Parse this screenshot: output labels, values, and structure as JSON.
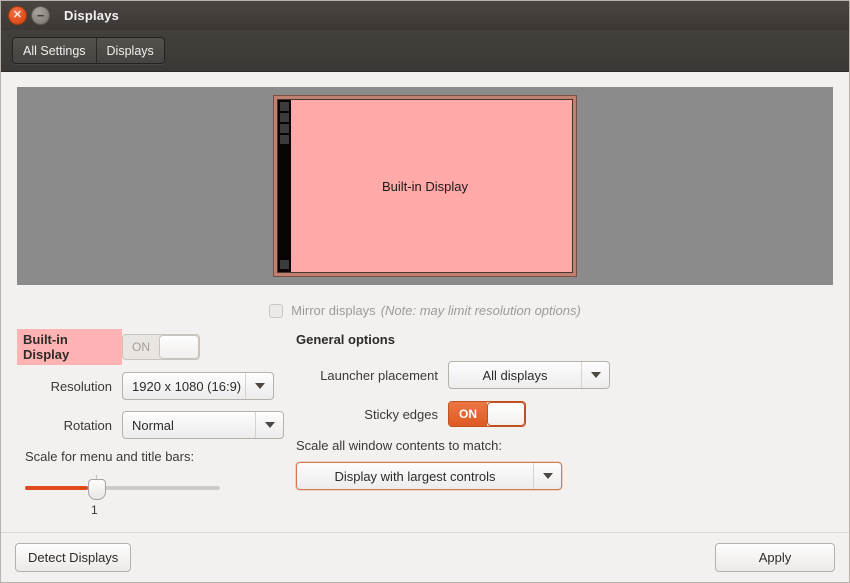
{
  "window": {
    "title": "Displays",
    "close_icon": "close-icon",
    "minimize_icon": "minimize-icon"
  },
  "toolbar": {
    "buttons": [
      {
        "label": "All Settings"
      },
      {
        "label": "Displays"
      }
    ]
  },
  "preview": {
    "monitor_label": "Built-in Display",
    "screen_color": "#ffa9a9",
    "bezel_color": "#c08070",
    "background_color": "#8b8b8b",
    "launcher_color": "#080404"
  },
  "mirror": {
    "label": "Mirror displays",
    "note": "(Note: may limit resolution options)",
    "checked": false,
    "enabled": false
  },
  "display_settings": {
    "name": "Built-in Display",
    "name_highlight_color": "#ffb3b3",
    "power_toggle": {
      "label": "ON",
      "state": "on",
      "enabled": false
    },
    "resolution": {
      "label": "Resolution",
      "value": "1920 x 1080 (16:9)"
    },
    "rotation": {
      "label": "Rotation",
      "value": "Normal"
    },
    "scale_menu_title_bars": {
      "caption": "Scale for menu and title bars:",
      "value": "1",
      "fill_color": "#e0491a"
    }
  },
  "general_options": {
    "header": "General options",
    "launcher_placement": {
      "label": "Launcher placement",
      "value": "All displays"
    },
    "sticky_edges": {
      "label": "Sticky edges",
      "toggle_label": "ON",
      "state": "on",
      "accent_color": "#dd5a22"
    },
    "scale_all_window_contents": {
      "caption": "Scale all window contents to match:",
      "value": "Display with largest controls",
      "focus_border_color": "#d4794e"
    }
  },
  "actions": {
    "detect_displays": "Detect Displays",
    "apply": "Apply"
  }
}
